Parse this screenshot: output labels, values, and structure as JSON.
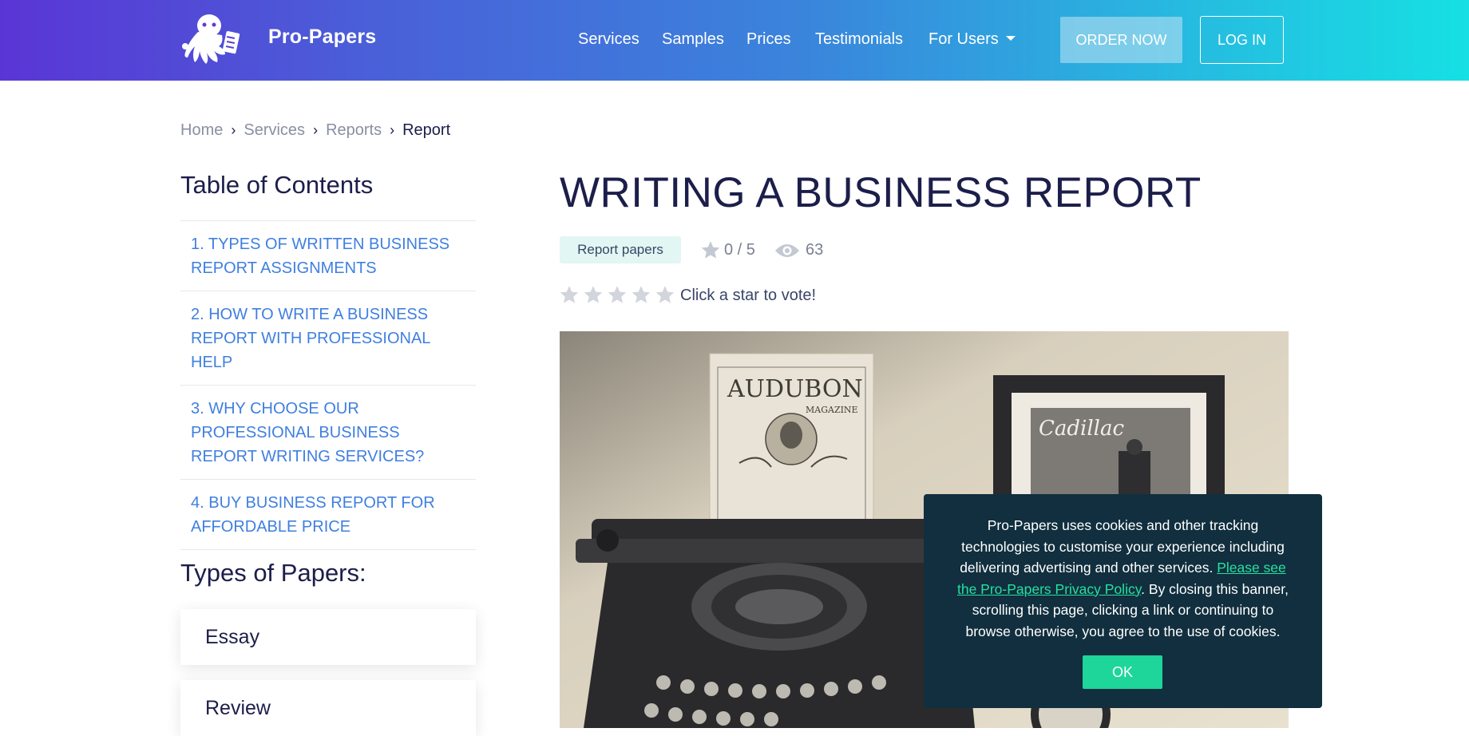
{
  "header": {
    "brand": "Pro-Papers",
    "nav": [
      "Services",
      "Samples",
      "Prices",
      "Testimonials",
      "For Users"
    ],
    "order_label": "ORDER NOW",
    "login_label": "LOG IN"
  },
  "breadcrumb": [
    "Home",
    "Services",
    "Reports",
    "Report"
  ],
  "sidebar": {
    "toc_title": "Table of Contents",
    "toc": [
      "1. TYPES OF WRITTEN BUSINESS REPORT ASSIGNMENTS",
      "2. HOW TO WRITE A BUSINESS REPORT WITH PROFESSIONAL HELP",
      "3. WHY CHOOSE OUR PROFESSIONAL BUSINESS REPORT WRITING SERVICES?",
      "4. BUY BUSINESS REPORT FOR AFFORDABLE PRICE"
    ],
    "types_title": "Types of Papers:",
    "types": [
      "Essay",
      "Review"
    ]
  },
  "article": {
    "title": "WRITING A BUSINESS REPORT",
    "tag": "Report papers",
    "rating": "0 / 5",
    "views": "63",
    "vote_prompt": "Click a star to vote!",
    "image_labels": {
      "magazine": "AUDUBON",
      "magazine_sub": "MAGAZINE",
      "frame": "Cadillac"
    }
  },
  "cookie": {
    "text_before": "Pro-Papers uses cookies and other tracking technologies to customise your experience including delivering advertising and other services. ",
    "link": "Please see the Pro-Papers Privacy Policy",
    "text_after": ". By closing this banner, scrolling this page, clicking a link or continuing to browse otherwise, you agree to the use of cookies.",
    "ok_label": "OK"
  },
  "colors": {
    "header_start": "#5a35d5",
    "header_end": "#16e0e3",
    "link": "#3f7fe0",
    "heading": "#1c1e4a",
    "cookie_bg": "#112f3e",
    "cookie_accent": "#1ed59a"
  }
}
